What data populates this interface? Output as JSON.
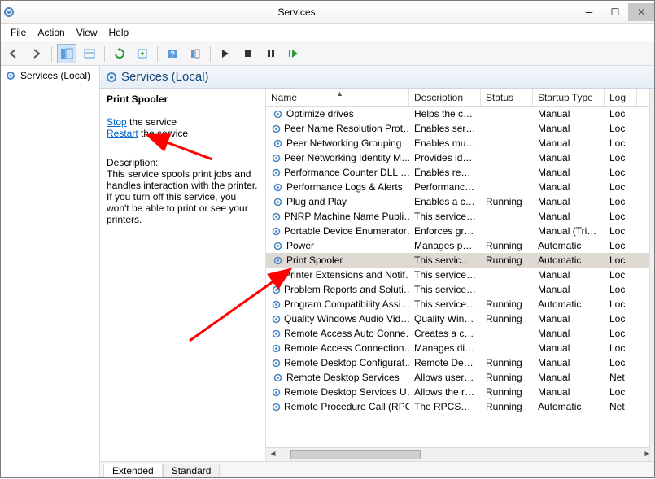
{
  "window": {
    "title": "Services"
  },
  "menu": {
    "file": "File",
    "action": "Action",
    "view": "View",
    "help": "Help"
  },
  "tree": {
    "root": "Services (Local)"
  },
  "panel": {
    "heading": "Services (Local)"
  },
  "detail": {
    "service_name": "Print Spooler",
    "stop_link": "Stop",
    "stop_suffix": " the service",
    "restart_link": "Restart",
    "restart_suffix": " the service",
    "desc_label": "Description:",
    "desc_text": "This service spools print jobs and handles interaction with the printer. If you turn off this service, you won't be able to print or see your printers."
  },
  "columns": {
    "name": "Name",
    "description": "Description",
    "status": "Status",
    "startup": "Startup Type",
    "logon": "Log"
  },
  "column_widths": {
    "name": 176,
    "description": 88,
    "status": 64,
    "startup": 88,
    "logon": 40
  },
  "rows": [
    {
      "n": "Optimize drives",
      "d": "Helps the c…",
      "s": "",
      "t": "Manual",
      "l": "Loc",
      "sel": false
    },
    {
      "n": "Peer Name Resolution Prot…",
      "d": "Enables serv…",
      "s": "",
      "t": "Manual",
      "l": "Loc",
      "sel": false
    },
    {
      "n": "Peer Networking Grouping",
      "d": "Enables mul…",
      "s": "",
      "t": "Manual",
      "l": "Loc",
      "sel": false
    },
    {
      "n": "Peer Networking Identity M…",
      "d": "Provides ide…",
      "s": "",
      "t": "Manual",
      "l": "Loc",
      "sel": false
    },
    {
      "n": "Performance Counter DLL …",
      "d": "Enables rem…",
      "s": "",
      "t": "Manual",
      "l": "Loc",
      "sel": false
    },
    {
      "n": "Performance Logs & Alerts",
      "d": "Performanc…",
      "s": "",
      "t": "Manual",
      "l": "Loc",
      "sel": false
    },
    {
      "n": "Plug and Play",
      "d": "Enables a c…",
      "s": "Running",
      "t": "Manual",
      "l": "Loc",
      "sel": false
    },
    {
      "n": "PNRP Machine Name Publi…",
      "d": "This service…",
      "s": "",
      "t": "Manual",
      "l": "Loc",
      "sel": false
    },
    {
      "n": "Portable Device Enumerator…",
      "d": "Enforces gr…",
      "s": "",
      "t": "Manual (Trig…",
      "l": "Loc",
      "sel": false
    },
    {
      "n": "Power",
      "d": "Manages p…",
      "s": "Running",
      "t": "Automatic",
      "l": "Loc",
      "sel": false
    },
    {
      "n": "Print Spooler",
      "d": "This service …",
      "s": "Running",
      "t": "Automatic",
      "l": "Loc",
      "sel": true
    },
    {
      "n": "Printer Extensions and Notif…",
      "d": "This service…",
      "s": "",
      "t": "Manual",
      "l": "Loc",
      "sel": false
    },
    {
      "n": "Problem Reports and Soluti…",
      "d": "This service…",
      "s": "",
      "t": "Manual",
      "l": "Loc",
      "sel": false
    },
    {
      "n": "Program Compatibility Assi…",
      "d": "This service…",
      "s": "Running",
      "t": "Automatic",
      "l": "Loc",
      "sel": false
    },
    {
      "n": "Quality Windows Audio Vid…",
      "d": "Quality Win…",
      "s": "Running",
      "t": "Manual",
      "l": "Loc",
      "sel": false
    },
    {
      "n": "Remote Access Auto Conne…",
      "d": "Creates a co…",
      "s": "",
      "t": "Manual",
      "l": "Loc",
      "sel": false
    },
    {
      "n": "Remote Access Connection…",
      "d": "Manages di…",
      "s": "",
      "t": "Manual",
      "l": "Loc",
      "sel": false
    },
    {
      "n": "Remote Desktop Configurat…",
      "d": "Remote Des…",
      "s": "Running",
      "t": "Manual",
      "l": "Loc",
      "sel": false
    },
    {
      "n": "Remote Desktop Services",
      "d": "Allows user…",
      "s": "Running",
      "t": "Manual",
      "l": "Net",
      "sel": false
    },
    {
      "n": "Remote Desktop Services U…",
      "d": "Allows the r…",
      "s": "Running",
      "t": "Manual",
      "l": "Loc",
      "sel": false
    },
    {
      "n": "Remote Procedure Call (RPC)",
      "d": "The RPCSS …",
      "s": "Running",
      "t": "Automatic",
      "l": "Net",
      "sel": false
    }
  ],
  "tabs": {
    "extended": "Extended",
    "standard": "Standard"
  }
}
